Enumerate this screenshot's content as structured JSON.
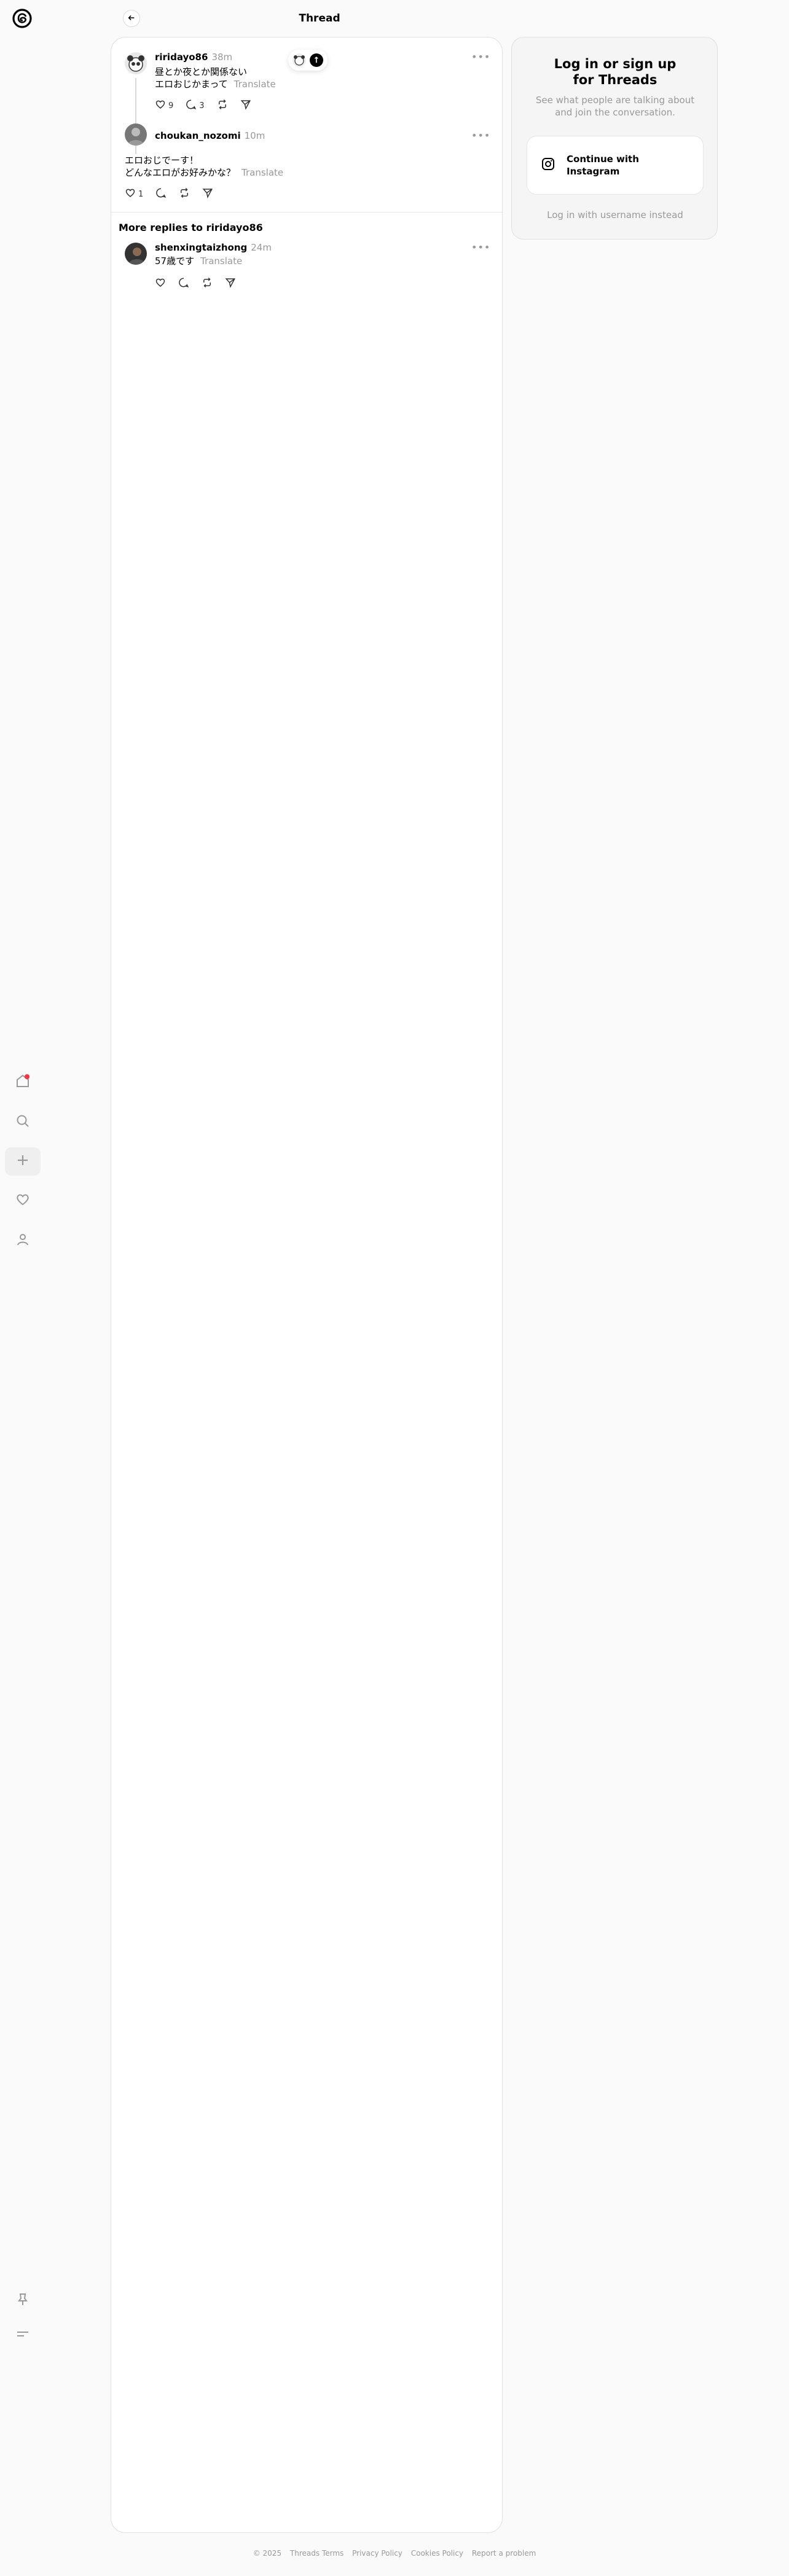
{
  "header": {
    "title": "Thread"
  },
  "main_post": {
    "username": "riridayo86",
    "time": "38m",
    "lines": [
      "昼とか夜とか関係ない",
      "エロおじかまって"
    ],
    "translate": "Translate",
    "likes": "9",
    "replies": "3"
  },
  "reply": {
    "username": "choukan_nozomi",
    "time": "10m",
    "lines": [
      "エロおじでーす！",
      "どんなエロがお好みかな？"
    ],
    "translate": "Translate",
    "likes": "1"
  },
  "more_replies": {
    "title": "More replies to riridayo86",
    "post": {
      "username": "shenxingtaizhong",
      "time": "24m",
      "text": "57歳です",
      "translate": "Translate"
    }
  },
  "login": {
    "title_line1": "Log in or sign up",
    "title_line2": "for Threads",
    "subtitle": "See what people are talking about and join the conversation.",
    "instagram_button": "Continue with Instagram",
    "username_link": "Log in with username instead"
  },
  "footer": {
    "copyright": "© 2025",
    "links": [
      "Threads Terms",
      "Privacy Policy",
      "Cookies Policy",
      "Report a problem"
    ]
  },
  "more_icon": "•••"
}
